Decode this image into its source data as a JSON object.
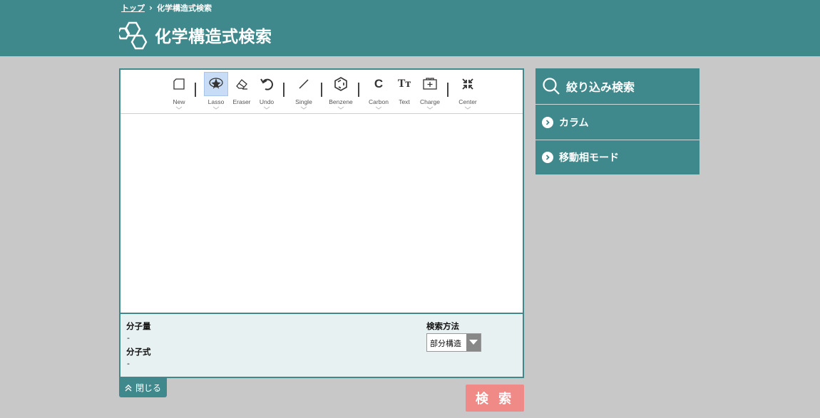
{
  "header": {
    "breadcrumb": {
      "home": "トップ",
      "separator": "›",
      "current": "化学構造式検索"
    },
    "title": "化学構造式検索"
  },
  "toolbar": {
    "tools": [
      {
        "label": "New",
        "icon": "new-file-icon"
      },
      {
        "label": "Lasso",
        "icon": "lasso-icon",
        "active": true
      },
      {
        "label": "Eraser",
        "icon": "eraser-icon"
      },
      {
        "label": "Undo",
        "icon": "undo-icon"
      },
      {
        "label": "Single",
        "icon": "single-bond-icon"
      },
      {
        "label": "Benzene",
        "icon": "benzene-icon"
      },
      {
        "label": "Carbon",
        "icon": "carbon-icon",
        "glyph": "C"
      },
      {
        "label": "Text",
        "icon": "text-icon",
        "glyph": "Tт"
      },
      {
        "label": "Charge",
        "icon": "charge-icon"
      },
      {
        "label": "Center",
        "icon": "center-icon"
      }
    ]
  },
  "info": {
    "mw_label": "分子量",
    "mw_value": "-",
    "formula_label": "分子式",
    "formula_value": "-",
    "method_label": "検索方法",
    "method_value": "部分構造"
  },
  "buttons": {
    "close": "閉じる",
    "search": "検 索"
  },
  "sidebar": {
    "title": "絞り込み検索",
    "items": [
      {
        "label": "カラム"
      },
      {
        "label": "移動相モード"
      }
    ]
  },
  "colors": {
    "primary": "#3f888b",
    "background": "#c8c8c8",
    "search_button": "#f08a87",
    "info_panel": "#e8f1f2"
  }
}
